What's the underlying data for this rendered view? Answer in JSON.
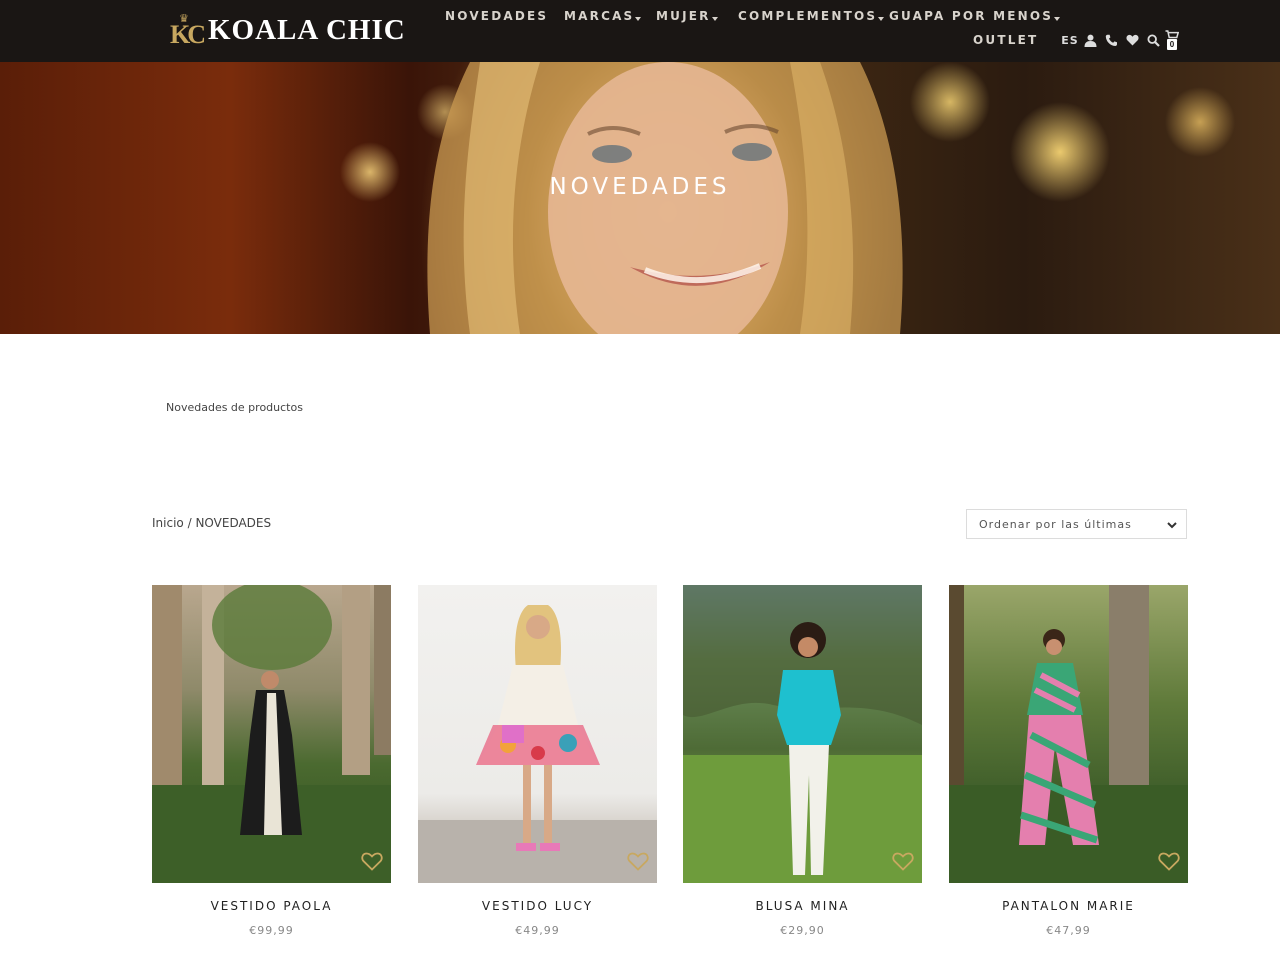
{
  "colors": {
    "header_bg": "#1a1614",
    "accent_gold": "#c8a860",
    "wishlist_gold": "#c8a860"
  },
  "brand": {
    "logo_text": "KOALA CHIC",
    "logo_monogram": "KC"
  },
  "nav": {
    "items": [
      {
        "label": "NOVEDADES",
        "has_dropdown": false
      },
      {
        "label": "MARCAS",
        "has_dropdown": true
      },
      {
        "label": "MUJER",
        "has_dropdown": true
      },
      {
        "label": "COMPLEMENTOS",
        "has_dropdown": true
      },
      {
        "label": "GUAPA POR MENOS",
        "has_dropdown": true
      },
      {
        "label": "OUTLET",
        "has_dropdown": false
      }
    ]
  },
  "tools": {
    "language": "ES",
    "icons": [
      "user-icon",
      "phone-icon",
      "heart-icon",
      "search-icon",
      "cart-icon"
    ],
    "cart_count": "0"
  },
  "hero": {
    "title": "NOVEDADES"
  },
  "category_description": "Novedades de productos",
  "breadcrumb": {
    "home": "Inicio",
    "separator": " / ",
    "current": "NOVEDADES"
  },
  "sort": {
    "selected": "Ordenar por las últimas"
  },
  "products": [
    {
      "name": "VESTIDO PAOLA",
      "price": "€99,99"
    },
    {
      "name": "VESTIDO LUCY",
      "price": "€49,99"
    },
    {
      "name": "BLUSA MINA",
      "price": "€29,90"
    },
    {
      "name": "PANTALON MARIE",
      "price": "€47,99"
    }
  ]
}
